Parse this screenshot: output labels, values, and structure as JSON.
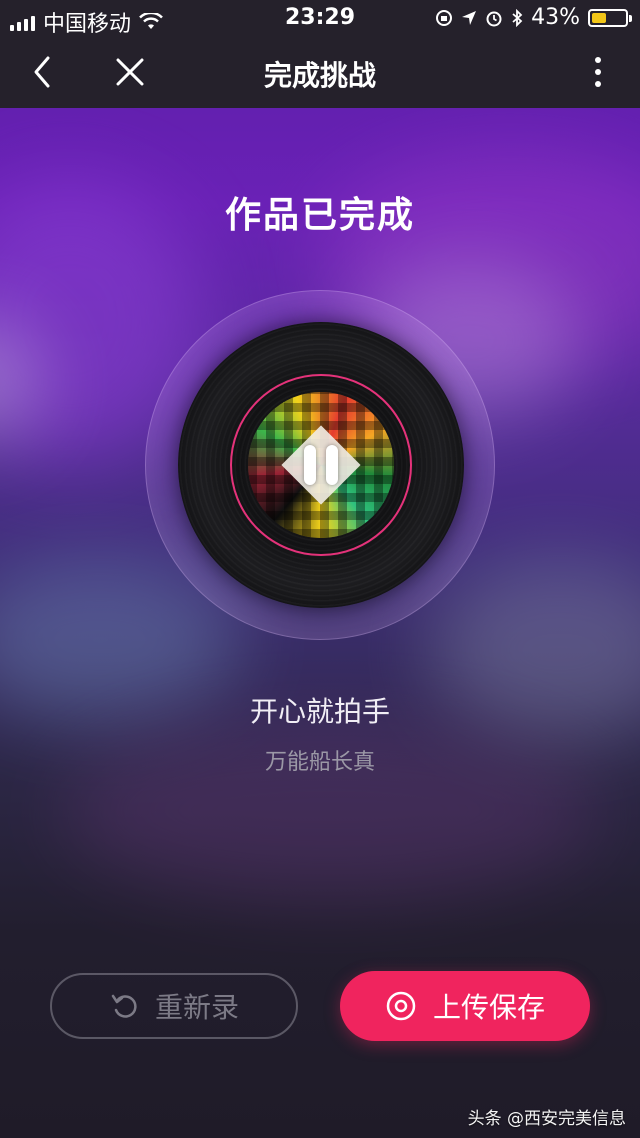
{
  "status_bar": {
    "carrier": "中国移动",
    "time": "23:29",
    "battery_percent": "43%",
    "battery_level": 0.43,
    "icons": [
      "signal-icon",
      "wifi-icon",
      "orientation-lock-icon",
      "location-icon",
      "alarm-icon",
      "bluetooth-icon",
      "battery-icon"
    ]
  },
  "nav": {
    "title": "完成挑战",
    "back_icon": "back-arrow-icon",
    "close_icon": "close-icon",
    "more_icon": "more-vertical-icon"
  },
  "main": {
    "heading": "作品已完成",
    "song_title": "开心就拍手",
    "song_artist": "万能船长真"
  },
  "actions": {
    "rerecord_label": "重新录",
    "upload_label": "上传保存"
  },
  "colors": {
    "accent": "#f0245e",
    "ring": "#e5327a",
    "battery_fill": "#f2c618"
  },
  "watermark": "头条 @西安完美信息"
}
